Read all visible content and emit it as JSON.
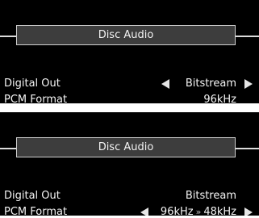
{
  "screens": [
    {
      "title": "Disc Audio",
      "rows": [
        {
          "label": "Digital Out",
          "value": "Bitstream"
        },
        {
          "label": "PCM Format",
          "value": "96kHz"
        }
      ]
    },
    {
      "title": "Disc Audio",
      "rows": [
        {
          "label": "Digital Out",
          "value": "Bitstream"
        },
        {
          "label": "PCM Format",
          "value_from": "96kHz",
          "value_sep": "»",
          "value_to": "48kHz"
        }
      ]
    }
  ],
  "colors": {
    "background": "#000000",
    "text": "#f4f4f4",
    "title_box": "#3d3d3d",
    "rule": "#dcdcdc"
  },
  "icons": {
    "left": "triangle-left-icon",
    "right": "triangle-right-icon"
  }
}
